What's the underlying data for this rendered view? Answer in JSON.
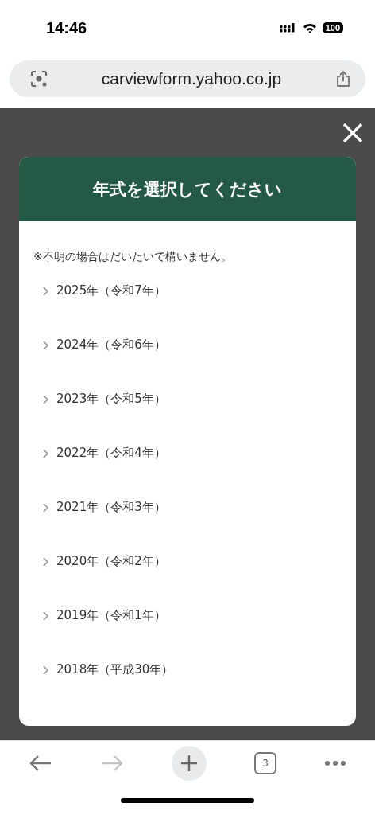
{
  "status_bar": {
    "time": "14:46",
    "battery": "100"
  },
  "address_bar": {
    "url": "carviewform.yahoo.co.jp"
  },
  "modal": {
    "title": "年式を選択してください",
    "note": "※不明の場合はだいたいで構いません。",
    "items": [
      {
        "label": "2025年（令和7年）"
      },
      {
        "label": "2024年（令和6年）"
      },
      {
        "label": "2023年（令和5年）"
      },
      {
        "label": "2022年（令和4年）"
      },
      {
        "label": "2021年（令和3年）"
      },
      {
        "label": "2020年（令和2年）"
      },
      {
        "label": "2019年（令和1年）"
      },
      {
        "label": "2018年（平成30年）"
      }
    ]
  },
  "toolbar": {
    "back_disabled": false,
    "forward_disabled": true,
    "tab_count": "3"
  }
}
